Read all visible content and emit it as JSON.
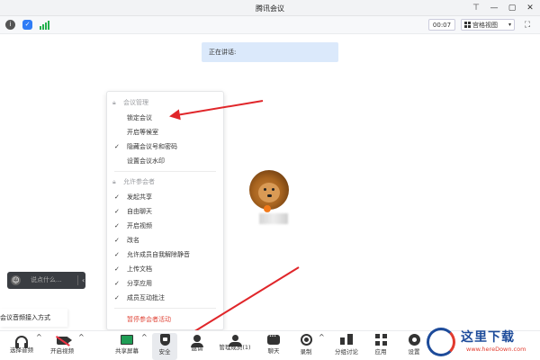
{
  "window": {
    "title": "腾讯会议",
    "controls": [
      "pin-icon",
      "minimize-icon",
      "restore-icon",
      "close-icon"
    ]
  },
  "infobar": {
    "icons": [
      "info-icon",
      "shield-icon",
      "signal-icon"
    ],
    "timer": "00:07",
    "view_mode": "宫格视图",
    "colors": {
      "shield": "#2f7cf6",
      "signal": "#22b14c"
    }
  },
  "speaking": {
    "label": "正在讲话:"
  },
  "security_menu": {
    "section_meeting": {
      "header": "会议管理",
      "items": [
        {
          "label": "锁定会议",
          "checked": false
        },
        {
          "label": "开启等候室",
          "checked": false
        },
        {
          "label": "隐藏会议号和密码",
          "checked": true
        },
        {
          "label": "设置会议水印",
          "checked": false
        }
      ]
    },
    "section_participants": {
      "header": "允许参会者",
      "items": [
        {
          "label": "发起共享",
          "checked": true
        },
        {
          "label": "自由聊天",
          "checked": true
        },
        {
          "label": "开启视频",
          "checked": true
        },
        {
          "label": "改名",
          "checked": true
        },
        {
          "label": "允许成员自我解除静音",
          "checked": true
        },
        {
          "label": "上传文档",
          "checked": true
        },
        {
          "label": "分享应用",
          "checked": true
        },
        {
          "label": "成员互动批注",
          "checked": true
        }
      ]
    },
    "danger_action": "暂停参会者活动",
    "danger_color": "#e0473a"
  },
  "chat_input": {
    "placeholder": "说点什么..."
  },
  "audio_hint": "会议音频接入方式",
  "toolbar": {
    "items": [
      {
        "label": "选择音频",
        "icon": "headset-icon"
      },
      {
        "label": "开启视频",
        "icon": "camera-off-icon"
      },
      {
        "label": "共享屏幕",
        "icon": "share-screen-icon"
      },
      {
        "label": "安全",
        "icon": "shield-icon"
      },
      {
        "label": "邀请",
        "icon": "invite-icon"
      },
      {
        "label": "管理成员(1)",
        "icon": "members-icon"
      },
      {
        "label": "聊天",
        "icon": "chat-icon"
      },
      {
        "label": "录制",
        "icon": "record-icon"
      },
      {
        "label": "分组讨论",
        "icon": "breakout-icon"
      },
      {
        "label": "应用",
        "icon": "apps-icon"
      },
      {
        "label": "设置",
        "icon": "gear-icon"
      }
    ]
  },
  "watermark": {
    "text": "这里下载",
    "url": "www.hereDown.com"
  }
}
